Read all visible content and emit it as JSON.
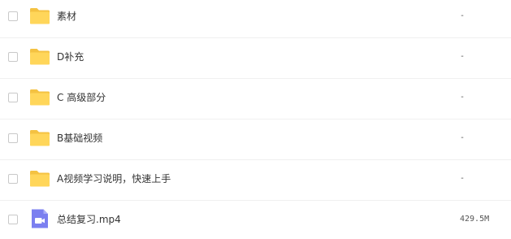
{
  "files": [
    {
      "name": "素材",
      "size": "-",
      "type": "folder",
      "icon": "folder-icon"
    },
    {
      "name": "D补充",
      "size": "-",
      "type": "folder",
      "icon": "folder-icon"
    },
    {
      "name": "C 高级部分",
      "size": "-",
      "type": "folder",
      "icon": "folder-icon"
    },
    {
      "name": "B基础视频",
      "size": "-",
      "type": "folder",
      "icon": "folder-icon"
    },
    {
      "name": "A视频学习说明，快速上手",
      "size": "-",
      "type": "folder",
      "icon": "folder-icon"
    },
    {
      "name": "总结复习.mp4",
      "size": "429.5M",
      "type": "video",
      "icon": "video-file-icon"
    }
  ],
  "colors": {
    "folder": "#ffd65a",
    "folder_tab": "#f4c242",
    "video": "#7b7ff0"
  }
}
